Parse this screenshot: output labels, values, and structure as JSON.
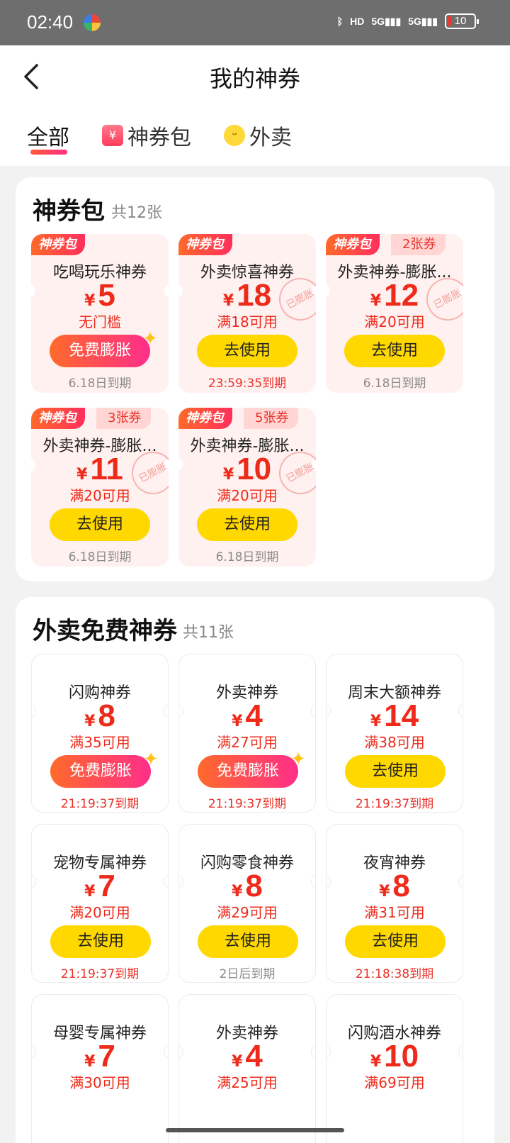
{
  "status_bar": {
    "time": "02:40",
    "hd": "HD",
    "net1": "5G",
    "net2": "5G",
    "battery": "10"
  },
  "header": {
    "title": "我的神券"
  },
  "tabs": [
    {
      "label": "全部",
      "active": true
    },
    {
      "label": "神券包",
      "icon": "coupon-pack-icon"
    },
    {
      "label": "外卖",
      "icon": "rabbit-icon"
    }
  ],
  "pack_section": {
    "title": "神券包",
    "count": "共12张",
    "badge": "神券包",
    "stamp": "已膨胀",
    "coupons": [
      {
        "name": "吃喝玩乐神券",
        "yen": "¥",
        "amount": "5",
        "condition": "无门槛",
        "button": "免费膨胀",
        "expiry": "6.18日到期"
      },
      {
        "name": "外卖惊喜神券",
        "yen": "¥",
        "amount": "18",
        "condition": "满18可用",
        "button": "去使用",
        "expiry": "23:59:35到期"
      },
      {
        "name": "外卖神券-膨胀...",
        "qty": "2张券",
        "yen": "¥",
        "amount": "12",
        "condition": "满20可用",
        "button": "去使用",
        "expiry": "6.18日到期"
      },
      {
        "name": "外卖神券-膨胀...",
        "qty": "3张券",
        "yen": "¥",
        "amount": "11",
        "condition": "满20可用",
        "button": "去使用",
        "expiry": "6.18日到期"
      },
      {
        "name": "外卖神券-膨胀...",
        "qty": "5张券",
        "yen": "¥",
        "amount": "10",
        "condition": "满20可用",
        "button": "去使用",
        "expiry": "6.18日到期"
      }
    ]
  },
  "takeout_section": {
    "title": "外卖免费神券",
    "count": "共11张",
    "coupons": [
      {
        "name": "闪购神券",
        "yen": "¥",
        "amount": "8",
        "condition": "满35可用",
        "button": "免费膨胀",
        "expiry": "21:19:37到期"
      },
      {
        "name": "外卖神券",
        "yen": "¥",
        "amount": "4",
        "condition": "满27可用",
        "button": "免费膨胀",
        "expiry": "21:19:37到期"
      },
      {
        "name": "周末大额神券",
        "yen": "¥",
        "amount": "14",
        "condition": "满38可用",
        "button": "去使用",
        "expiry": "21:19:37到期"
      },
      {
        "name": "宠物专属神券",
        "yen": "¥",
        "amount": "7",
        "condition": "满20可用",
        "button": "去使用",
        "expiry": "21:19:37到期"
      },
      {
        "name": "闪购零食神券",
        "yen": "¥",
        "amount": "8",
        "condition": "满29可用",
        "button": "去使用",
        "expiry": "2日后到期"
      },
      {
        "name": "夜宵神券",
        "yen": "¥",
        "amount": "8",
        "condition": "满31可用",
        "button": "去使用",
        "expiry": "21:18:38到期"
      },
      {
        "name": "母婴专属神券",
        "yen": "¥",
        "amount": "7",
        "condition": "满30可用"
      },
      {
        "name": "外卖神券",
        "yen": "¥",
        "amount": "4",
        "condition": "满25可用"
      },
      {
        "name": "闪购酒水神券",
        "yen": "¥",
        "amount": "10",
        "condition": "满69可用"
      }
    ]
  }
}
